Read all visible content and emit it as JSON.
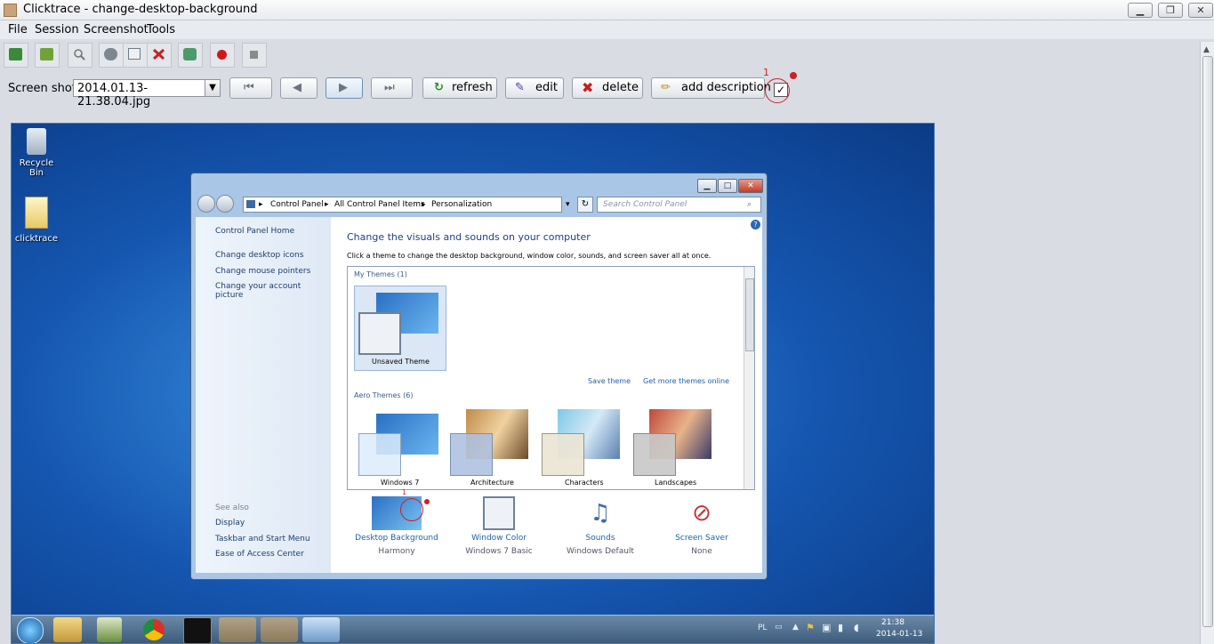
{
  "window": {
    "title": "Clicktrace - change-desktop-background",
    "controls": {
      "minimize": "▁",
      "restore": "❐",
      "close": "✕"
    }
  },
  "menu": [
    "File",
    "Session",
    "Screenshot",
    "Tools"
  ],
  "toolbar": {
    "icons": [
      "new-session-icon",
      "open-folder-icon",
      "search-icon",
      "settings-icon",
      "export-icon",
      "delete-session-icon",
      "refresh-session-icon",
      "record-icon",
      "stop-icon"
    ]
  },
  "screenshot_row": {
    "label": "Screen shot",
    "selected_file": "2014.01.13-21.38.04.jpg",
    "refresh_label": "refresh",
    "edit_label": "edit",
    "delete_label": "delete",
    "add_description_label": "add description",
    "annotation_number": "1"
  },
  "desktop": {
    "icons": [
      {
        "label": "Recycle Bin"
      },
      {
        "label": "clicktrace"
      }
    ]
  },
  "control_panel": {
    "breadcrumb": [
      "Control Panel",
      "All Control Panel Items",
      "Personalization"
    ],
    "search_placeholder": "Search Control Panel",
    "left_links": [
      "Control Panel Home",
      "Change desktop icons",
      "Change mouse pointers",
      "Change your account picture"
    ],
    "see_also_title": "See also",
    "see_also_links": [
      "Display",
      "Taskbar and Start Menu",
      "Ease of Access Center"
    ],
    "heading": "Change the visuals and sounds on your computer",
    "subheading": "Click a theme to change the desktop background, window color, sounds, and screen saver all at once.",
    "my_themes_title": "My Themes (1)",
    "unsaved_theme": "Unsaved Theme",
    "save_theme": "Save theme",
    "get_more_themes": "Get more themes online",
    "aero_themes_title": "Aero Themes (6)",
    "aero_themes": [
      "Windows 7",
      "Architecture",
      "Characters",
      "Landscapes"
    ],
    "bottom_items": [
      {
        "title": "Desktop Background",
        "value": "Harmony"
      },
      {
        "title": "Window Color",
        "value": "Windows 7 Basic"
      },
      {
        "title": "Sounds",
        "value": "Windows Default"
      },
      {
        "title": "Screen Saver",
        "value": "None"
      }
    ],
    "annotation_number": "1"
  },
  "taskbar": {
    "language": "PL",
    "time": "21:38",
    "date": "2014-01-13"
  }
}
